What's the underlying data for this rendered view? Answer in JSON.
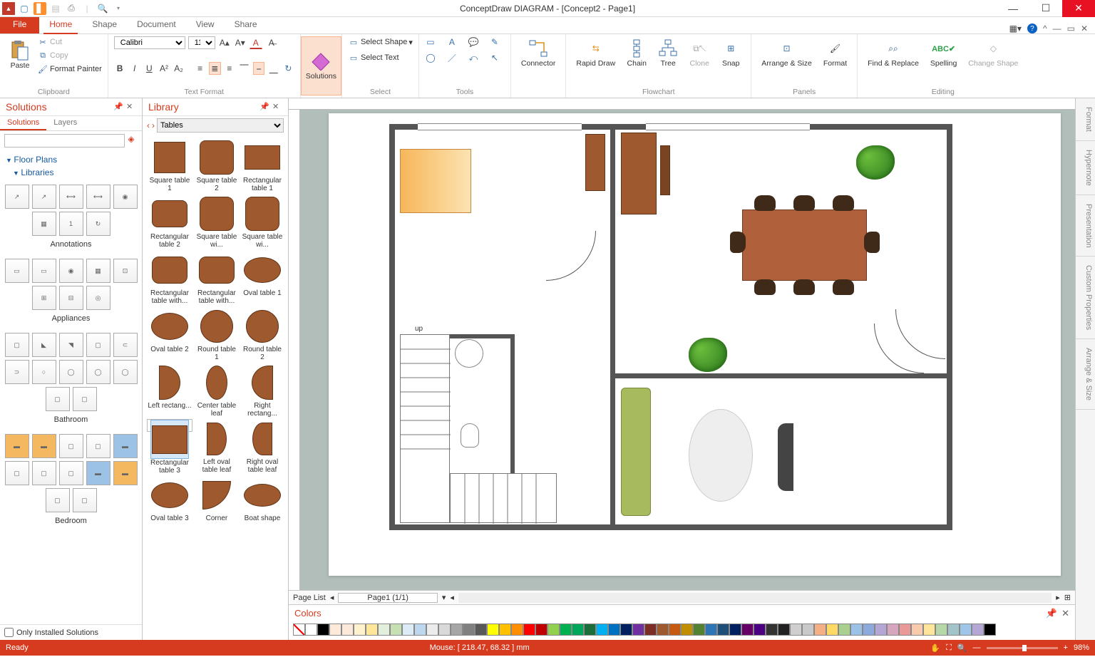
{
  "app": {
    "title": "ConceptDraw DIAGRAM - [Concept2 - Page1]"
  },
  "tabs": {
    "file": "File",
    "items": [
      "Home",
      "Shape",
      "Document",
      "View",
      "Share"
    ],
    "active": "Home"
  },
  "ribbon": {
    "clipboard": {
      "paste": "Paste",
      "cut": "Cut",
      "copy": "Copy",
      "fmtpainter": "Format Painter",
      "label": "Clipboard"
    },
    "text": {
      "font": "Calibri",
      "size": "11",
      "label": "Text Format"
    },
    "solutions": {
      "btn": "Solutions"
    },
    "select": {
      "shape": "Select Shape",
      "text": "Select Text",
      "label": "Select"
    },
    "tools": {
      "label": "Tools"
    },
    "connector": "Connector",
    "flow": {
      "rapid": "Rapid Draw",
      "chain": "Chain",
      "tree": "Tree",
      "clone": "Clone",
      "snap": "Snap",
      "label": "Flowchart"
    },
    "panels": {
      "arrange": "Arrange & Size",
      "format": "Format",
      "label": "Panels"
    },
    "editing": {
      "find": "Find & Replace",
      "spell": "Spelling",
      "change": "Change Shape",
      "label": "Editing"
    }
  },
  "solutions": {
    "title": "Solutions",
    "tab_solutions": "Solutions",
    "tab_layers": "Layers",
    "floorplans": "Floor Plans",
    "libraries": "Libraries",
    "cats": [
      "Annotations",
      "Appliances",
      "Bathroom",
      "Bedroom"
    ],
    "only": "Only Installed Solutions"
  },
  "library": {
    "title": "Library",
    "current": "Tables",
    "items": [
      "Square table 1",
      "Square table 2",
      "Rectangular table 1",
      "Rectangular table 2",
      "Square table wi...",
      "Square table wi...",
      "Rectangular table with...",
      "Rectangular table with...",
      "Oval table 1",
      "Oval table 2",
      "Round table 1",
      "Round table 2",
      "Left rectang...",
      "Center table leaf",
      "Right rectang...",
      "Rectangular table 3",
      "Left oval table leaf",
      "Right oval table leaf",
      "Oval table 3",
      "Corner",
      "Boat shape"
    ]
  },
  "canvas": {
    "stairs_label": "up"
  },
  "pagebar": {
    "list": "Page List",
    "page": "Page1 (1/1)"
  },
  "colors": {
    "title": "Colors",
    "swatches": [
      "#ffffff",
      "#000000",
      "#fdeada",
      "#fde9d9",
      "#fff2cc",
      "#ffe699",
      "#e2efda",
      "#c6e0b4",
      "#ddebf7",
      "#bdd7ee",
      "#ececec",
      "#d9d9d9",
      "#a6a6a6",
      "#808080",
      "#595959",
      "#ffff00",
      "#ffc000",
      "#ff8f00",
      "#ff0000",
      "#c00000",
      "#92d050",
      "#00b050",
      "#00a65a",
      "#1b6e3c",
      "#00b0f0",
      "#0070c0",
      "#002060",
      "#7030a0",
      "#7b2d26",
      "#9e5a2e",
      "#c55a11",
      "#bf8f00",
      "#548235",
      "#2e75b6",
      "#1f4e79",
      "#002060",
      "#660066",
      "#4b0082",
      "#333333",
      "#222222",
      "#d0cece",
      "#c9c9c9",
      "#f4b084",
      "#ffd966",
      "#a9d08e",
      "#9bc2e6",
      "#8ea9db",
      "#b4a7d6",
      "#d5a6bd",
      "#ea9999",
      "#f8cbad",
      "#ffe599",
      "#b6d7a8",
      "#a2c4c9",
      "#9fc5e8",
      "#b4a7d6",
      "#000000"
    ]
  },
  "rtabs": [
    "Format",
    "Hypernote",
    "Presentation",
    "Custom Properties",
    "Arrange & Size"
  ],
  "status": {
    "ready": "Ready",
    "mouse": "Mouse: [ 218.47, 68.32 ] mm",
    "zoom": "98%"
  }
}
